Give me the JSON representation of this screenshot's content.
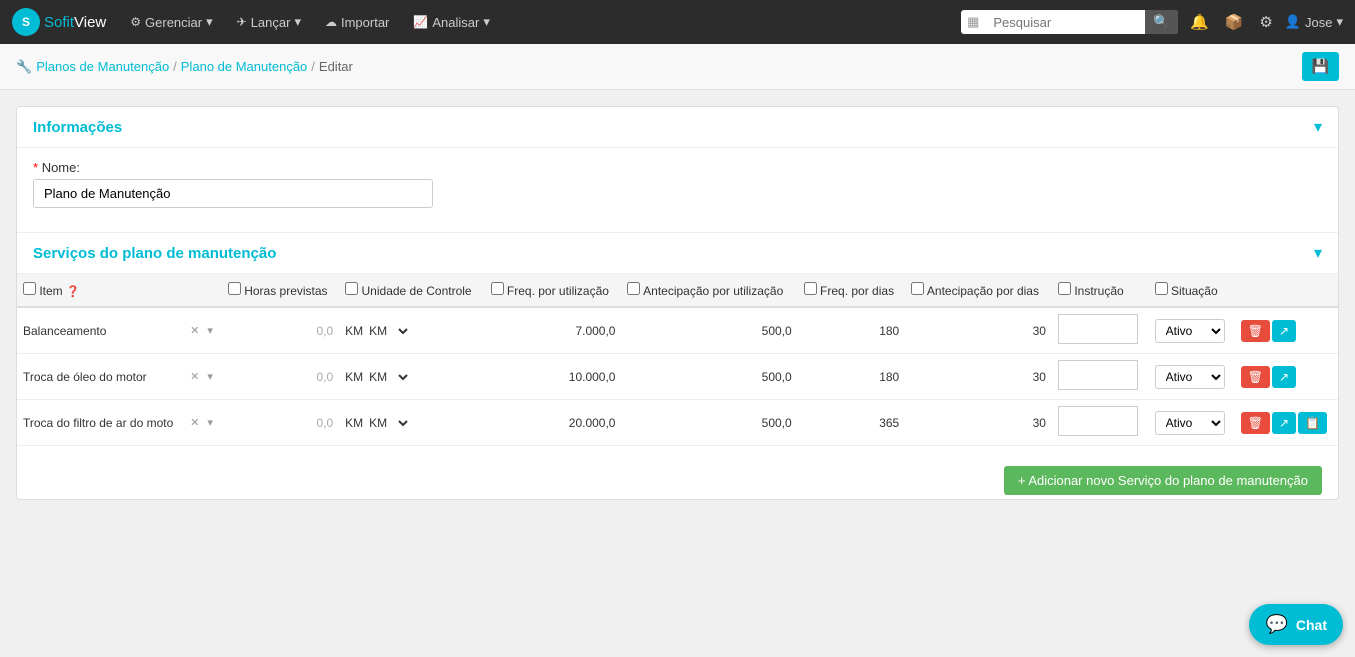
{
  "brand": {
    "logo_text": "S",
    "name_part1": "Sofit",
    "name_part2": "View"
  },
  "navbar": {
    "items": [
      {
        "id": "gerenciar",
        "label": "Gerenciar",
        "icon": "⚙",
        "has_dropdown": true
      },
      {
        "id": "lancar",
        "label": "Lançar",
        "icon": "✈",
        "has_dropdown": true
      },
      {
        "id": "importar",
        "label": "Importar",
        "icon": "☁",
        "has_dropdown": false
      },
      {
        "id": "analisar",
        "label": "Analisar",
        "icon": "📈",
        "has_dropdown": true
      }
    ],
    "search_placeholder": "Pesquisar",
    "user_name": "Jose"
  },
  "breadcrumb": {
    "items": [
      {
        "label": "Planos de Manutenção",
        "link": true
      },
      {
        "label": "Plano de Manutenção",
        "link": true
      },
      {
        "label": "Editar",
        "link": false
      }
    ]
  },
  "informacoes": {
    "title": "Informações",
    "nome_label": "Nome:",
    "nome_required": "*",
    "nome_value": "Plano de Manutenção"
  },
  "servicos": {
    "title": "Serviços do plano de manutenção",
    "columns": [
      "Item",
      "Horas previstas",
      "Unidade de Controle",
      "Freq. por utilização",
      "Antecipação por utilização",
      "Freq. por dias",
      "Antecipação por dias",
      "Instrução",
      "Situação"
    ],
    "rows": [
      {
        "item": "Balanceamento",
        "horas": "0,0",
        "unidade": "KM",
        "freq_util": "7.000,0",
        "antec_util": "500,0",
        "freq_dias": "180",
        "antec_dias": "30",
        "instrucao": "",
        "situacao": "Ativo"
      },
      {
        "item": "Troca de óleo do motor",
        "horas": "0,0",
        "unidade": "KM",
        "freq_util": "10.000,0",
        "antec_util": "500,0",
        "freq_dias": "180",
        "antec_dias": "30",
        "instrucao": "",
        "situacao": "Ativo"
      },
      {
        "item": "Troca do filtro de ar do moto",
        "horas": "0,0",
        "unidade": "KM",
        "freq_util": "20.000,0",
        "antec_util": "500,0",
        "freq_dias": "365",
        "antec_dias": "30",
        "instrucao": "",
        "situacao": "Ativo"
      }
    ],
    "add_button": "+ Adicionar novo Serviço do plano de manutenção"
  },
  "chat": {
    "label": "Chat"
  },
  "buttons": {
    "save_icon": "💾",
    "gravar": "Gravar"
  }
}
